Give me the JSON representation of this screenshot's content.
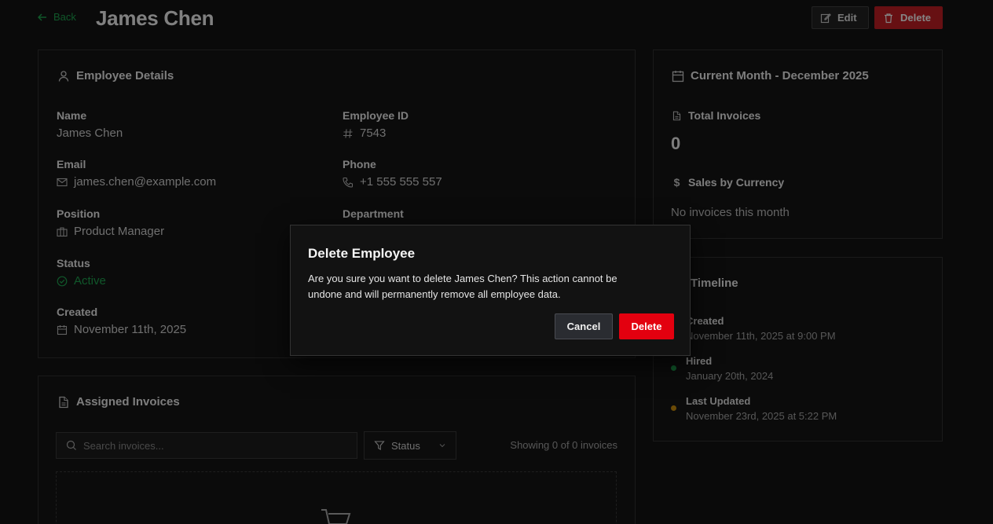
{
  "header": {
    "back_label": "Back",
    "title": "James Chen",
    "edit_label": "Edit",
    "delete_label": "Delete"
  },
  "employee_details": {
    "heading": "Employee Details",
    "name_label": "Name",
    "name": "James Chen",
    "id_label": "Employee ID",
    "id": "7543",
    "email_label": "Email",
    "email": "james.chen@example.com",
    "phone_label": "Phone",
    "phone": "+1 555 555 557",
    "position_label": "Position",
    "position": "Product Manager",
    "department_label": "Department",
    "status_label": "Status",
    "status": "Active",
    "created_label": "Created",
    "created": "November 11th, 2025"
  },
  "current_month": {
    "heading": "Current Month - December 2025",
    "total_invoices_label": "Total Invoices",
    "total_invoices": "0",
    "sales_label": "Sales by Currency",
    "sales_empty": "No invoices this month"
  },
  "timeline": {
    "heading": "Timeline",
    "items": [
      {
        "label": "Created",
        "time": "November 11th, 2025 at 9:00 PM",
        "color": "#16a34a"
      },
      {
        "label": "Hired",
        "time": "January 20th, 2024",
        "color": "#16a34a"
      },
      {
        "label": "Last Updated",
        "time": "November 23rd, 2025 at 5:22 PM",
        "color": "#ca8a04"
      }
    ]
  },
  "invoices": {
    "heading": "Assigned Invoices",
    "search_placeholder": "Search invoices...",
    "status_filter_label": "Status",
    "showing_text": "Showing 0 of 0 invoices"
  },
  "modal": {
    "title": "Delete Employee",
    "text": "Are you sure you want to delete James Chen? This action cannot be undone and will permanently remove all employee data.",
    "cancel_label": "Cancel",
    "confirm_label": "Delete"
  },
  "colors": {
    "accent_green": "#16a34a",
    "danger_red": "#e3000f",
    "warning_amber": "#ca8a04"
  }
}
